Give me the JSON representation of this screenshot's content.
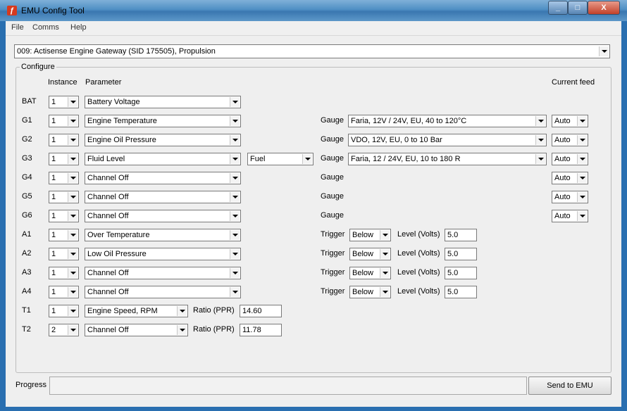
{
  "window": {
    "title": "EMU Config Tool",
    "app_icon": "flash-icon",
    "min": "_",
    "max": "□",
    "close": "X"
  },
  "menu": [
    "File",
    "Comms",
    "Help"
  ],
  "device": "009: Actisense Engine Gateway (SID 175505), Propulsion",
  "configure": {
    "legend": "Configure",
    "col_instance": "Instance",
    "col_parameter": "Parameter",
    "col_feed": "Current feed",
    "gauge_label": "Gauge",
    "trigger_label": "Trigger",
    "level_label": "Level (Volts)",
    "ratio_label": "Ratio (PPR)"
  },
  "rows": [
    {
      "id": "BAT",
      "instance": "1",
      "param": "Battery Voltage"
    },
    {
      "id": "G1",
      "instance": "1",
      "param": "Engine Temperature",
      "gauge": "Faria, 12V / 24V, EU, 40 to 120°C",
      "feed": "Auto"
    },
    {
      "id": "G2",
      "instance": "1",
      "param": "Engine Oil Pressure",
      "gauge": "VDO, 12V, EU, 0 to 10 Bar",
      "feed": "Auto"
    },
    {
      "id": "G3",
      "instance": "1",
      "param": "Fluid Level",
      "fluid": "Fuel",
      "gauge": "Faria, 12 / 24V, EU, 10 to 180 R",
      "feed": "Auto"
    },
    {
      "id": "G4",
      "instance": "1",
      "param": "Channel Off",
      "feed": "Auto"
    },
    {
      "id": "G5",
      "instance": "1",
      "param": "Channel Off",
      "feed": "Auto"
    },
    {
      "id": "G6",
      "instance": "1",
      "param": "Channel Off",
      "feed": "Auto"
    },
    {
      "id": "A1",
      "instance": "1",
      "param": "Over Temperature",
      "trigger": "Below",
      "level": "5.0"
    },
    {
      "id": "A2",
      "instance": "1",
      "param": "Low Oil Pressure",
      "trigger": "Below",
      "level": "5.0"
    },
    {
      "id": "A3",
      "instance": "1",
      "param": "Channel Off",
      "trigger": "Below",
      "level": "5.0"
    },
    {
      "id": "A4",
      "instance": "1",
      "param": "Channel Off",
      "trigger": "Below",
      "level": "5.0"
    },
    {
      "id": "T1",
      "instance": "1",
      "param": "Engine Speed, RPM",
      "ratio": "14.60"
    },
    {
      "id": "T2",
      "instance": "2",
      "param": "Channel Off",
      "ratio": "11.78"
    }
  ],
  "footer": {
    "progress_label": "Progress",
    "send_button": "Send to EMU"
  }
}
